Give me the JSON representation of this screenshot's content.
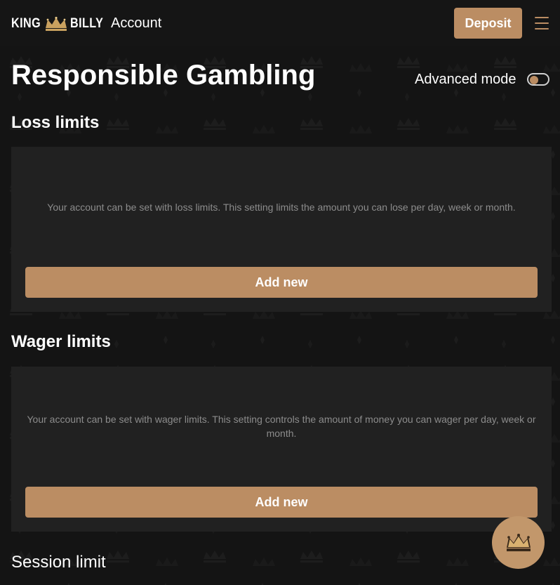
{
  "header": {
    "logo_left": "KING",
    "logo_right": "BILLY",
    "logo_icon": "crown-icon",
    "account_label": "Account",
    "deposit_label": "Deposit",
    "menu_icon": "hamburger-menu-icon"
  },
  "page": {
    "title": "Responsible Gambling",
    "advanced_mode_label": "Advanced mode",
    "advanced_mode_on": false
  },
  "sections": [
    {
      "title": "Loss limits",
      "description": "Your account can be set with loss limits. This setting limits the amount you can lose per day, week or month.",
      "button_label": "Add new"
    },
    {
      "title": "Wager limits",
      "description": "Your account can be set with wager limits. This setting controls the amount of money you can wager per day, week or month.",
      "button_label": "Add new"
    },
    {
      "title": "Session limit"
    }
  ],
  "fab": {
    "icon": "crown-icon"
  },
  "colors": {
    "accent": "#bb8d63",
    "background": "#141414",
    "card": "#212121",
    "muted_text": "#8c8c8c"
  }
}
